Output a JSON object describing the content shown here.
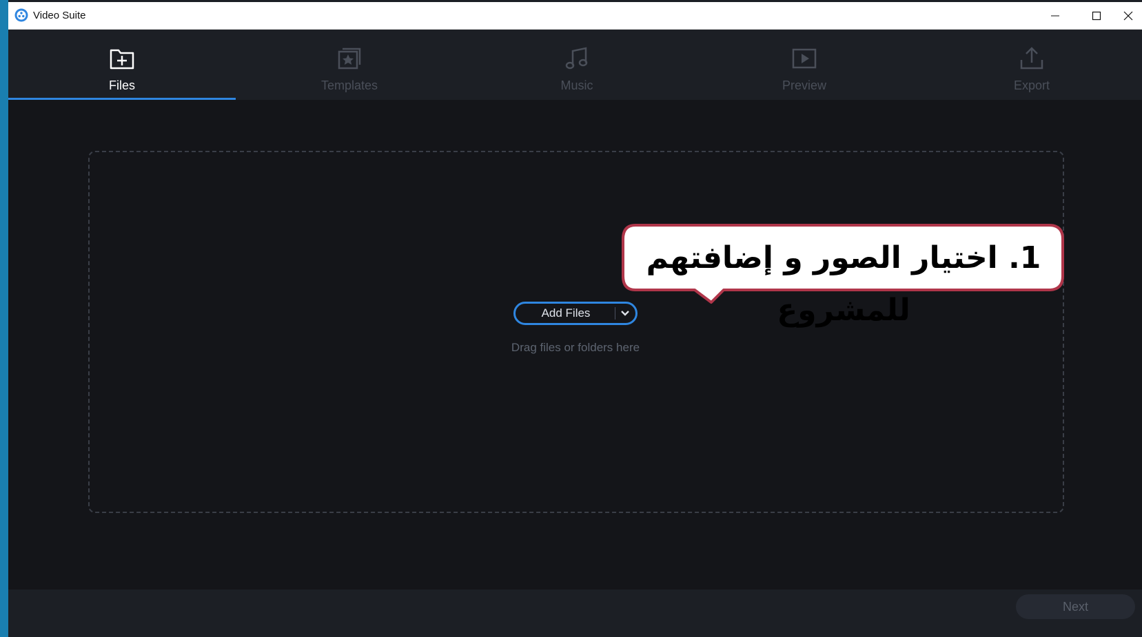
{
  "window": {
    "title": "Video Suite",
    "controls": [
      "minimize-icon",
      "maximize-icon",
      "close-icon"
    ]
  },
  "tabs": [
    {
      "label": "Files",
      "icon": "folder-plus-icon",
      "active": true
    },
    {
      "label": "Templates",
      "icon": "template-star-icon",
      "active": false
    },
    {
      "label": "Music",
      "icon": "music-note-icon",
      "active": false
    },
    {
      "label": "Preview",
      "icon": "play-preview-icon",
      "active": false
    },
    {
      "label": "Export",
      "icon": "export-upload-icon",
      "active": false
    }
  ],
  "dropzone": {
    "add_files_label": "Add Files",
    "hint": "Drag files or folders here"
  },
  "callout": {
    "text": "1. اختيار الصور و إضافتهم للمشروع"
  },
  "footer": {
    "next_label": "Next"
  },
  "colors": {
    "accent": "#2f86e0",
    "background": "#141519",
    "panel": "#1c1f25",
    "callout_border": "#b0364a",
    "inactive_text": "#4a4f59"
  }
}
